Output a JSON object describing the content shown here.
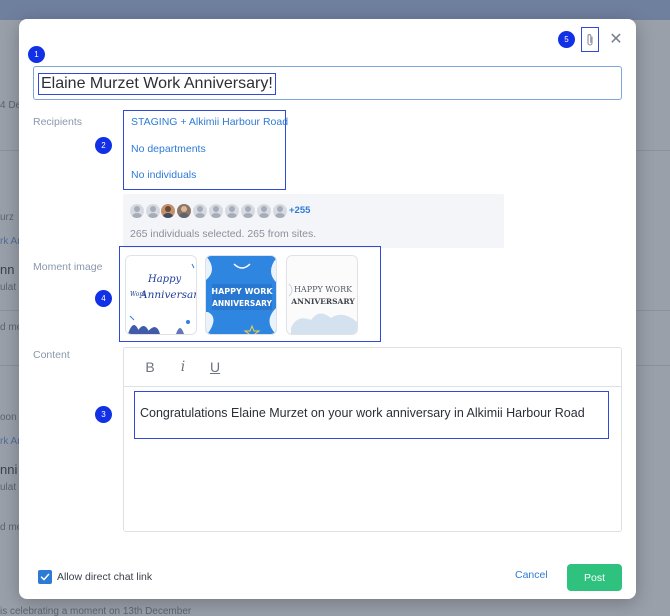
{
  "background": {
    "fragments": [
      "4 De",
      "urz",
      "rk An",
      "nn",
      "ulat",
      "d me",
      "oon",
      "rk An",
      "nni",
      "ulat",
      "d me",
      "is celebrating a moment on 13th December"
    ]
  },
  "markers": [
    "1",
    "2",
    "3",
    "4",
    "5"
  ],
  "modal": {
    "title_value": "Elaine Murzet Work Anniversary!",
    "close_glyph": "✕",
    "recipients": {
      "label": "Recipients",
      "site": "STAGING + Alkimii Harbour Road",
      "departments": "No departments",
      "individuals": "No individuals",
      "more_count": "+255",
      "selected_summary": "265 individuals selected. 265 from sites."
    },
    "moment_image": {
      "label": "Moment image",
      "images": [
        {
          "line1": "Happy",
          "line2": "Work",
          "line3": "Anniversary"
        },
        {
          "line1": "HAPPY WORK",
          "line2": "ANNIVERSARY"
        },
        {
          "line1": "HAPPY WORK",
          "line2": "ANNIVERSARY"
        }
      ]
    },
    "content": {
      "label": "Content",
      "bold": "B",
      "italic": "i",
      "underline": "U",
      "text": "Congratulations Elaine Murzet on your work anniversary in Alkimii Harbour Road"
    },
    "footer": {
      "allow_chat_label": "Allow direct chat link",
      "allow_chat_checked": true,
      "cancel_label": "Cancel",
      "post_label": "Post"
    }
  },
  "colors": {
    "accent": "#2e7bd6",
    "post": "#2ec27e",
    "marker": "#1230e6",
    "highlight": "#2f4bd6"
  },
  "icons": {
    "attach": "paperclip-icon",
    "close": "close-icon",
    "check": "check-icon"
  }
}
